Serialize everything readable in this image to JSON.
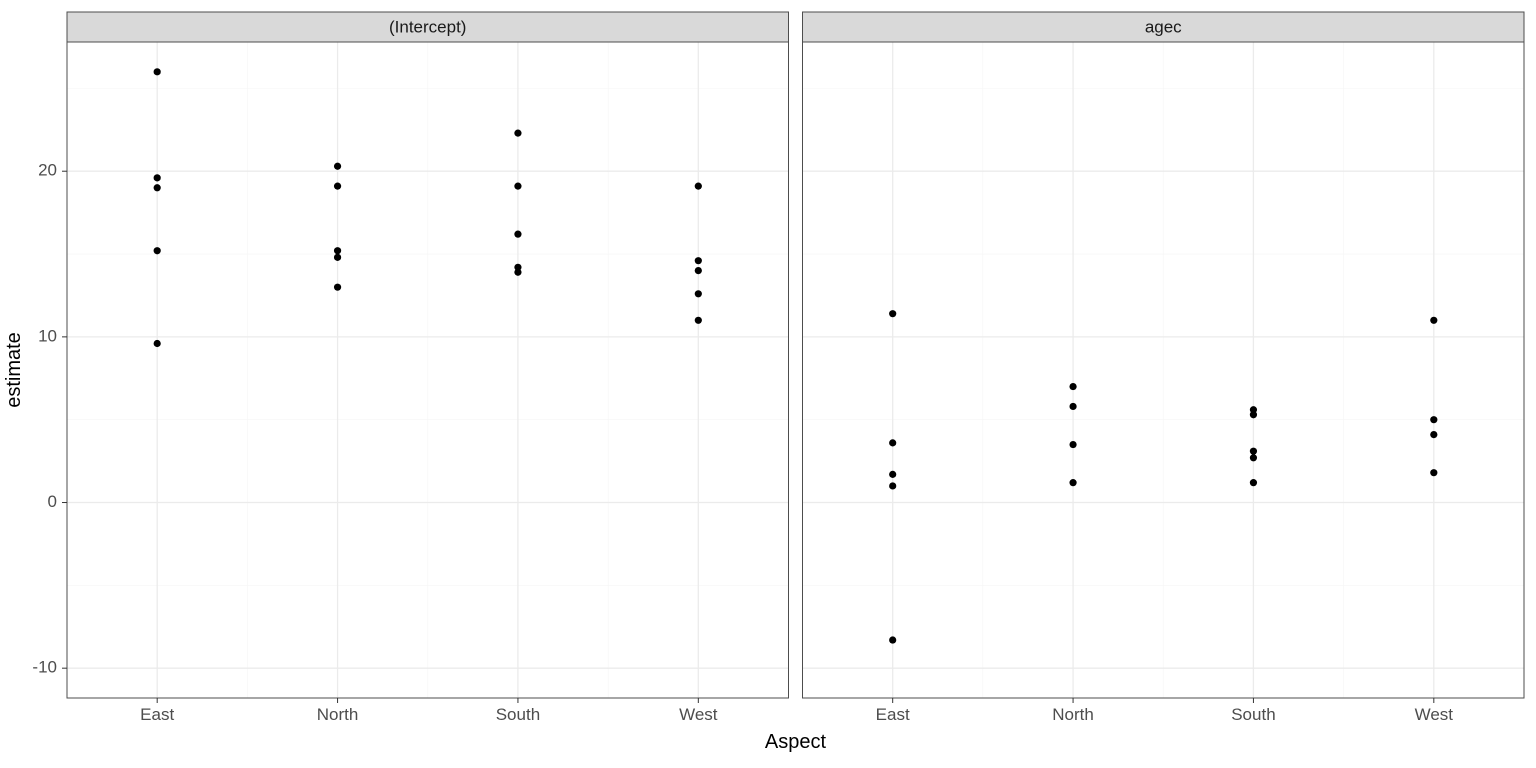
{
  "chart_data": [
    {
      "type": "scatter",
      "facet_label": "(Intercept)",
      "x_categories": [
        "East",
        "North",
        "South",
        "West"
      ],
      "series": [
        {
          "name": "(Intercept)",
          "points": [
            {
              "x": "East",
              "y": 26.0
            },
            {
              "x": "East",
              "y": 19.6
            },
            {
              "x": "East",
              "y": 19.0
            },
            {
              "x": "East",
              "y": 15.2
            },
            {
              "x": "East",
              "y": 9.6
            },
            {
              "x": "North",
              "y": 20.3
            },
            {
              "x": "North",
              "y": 19.1
            },
            {
              "x": "North",
              "y": 15.2
            },
            {
              "x": "North",
              "y": 14.8
            },
            {
              "x": "North",
              "y": 13.0
            },
            {
              "x": "South",
              "y": 22.3
            },
            {
              "x": "South",
              "y": 19.1
            },
            {
              "x": "South",
              "y": 16.2
            },
            {
              "x": "South",
              "y": 14.2
            },
            {
              "x": "South",
              "y": 13.9
            },
            {
              "x": "West",
              "y": 19.1
            },
            {
              "x": "West",
              "y": 14.6
            },
            {
              "x": "West",
              "y": 14.0
            },
            {
              "x": "West",
              "y": 12.6
            },
            {
              "x": "West",
              "y": 11.0
            }
          ]
        }
      ]
    },
    {
      "type": "scatter",
      "facet_label": "agec",
      "x_categories": [
        "East",
        "North",
        "South",
        "West"
      ],
      "series": [
        {
          "name": "agec",
          "points": [
            {
              "x": "East",
              "y": 11.4
            },
            {
              "x": "East",
              "y": 3.6
            },
            {
              "x": "East",
              "y": 1.7
            },
            {
              "x": "East",
              "y": 1.0
            },
            {
              "x": "East",
              "y": -8.3
            },
            {
              "x": "North",
              "y": 7.0
            },
            {
              "x": "North",
              "y": 5.8
            },
            {
              "x": "North",
              "y": 3.5
            },
            {
              "x": "North",
              "y": 1.2
            },
            {
              "x": "South",
              "y": 5.6
            },
            {
              "x": "South",
              "y": 5.3
            },
            {
              "x": "South",
              "y": 3.1
            },
            {
              "x": "South",
              "y": 2.7
            },
            {
              "x": "South",
              "y": 1.2
            },
            {
              "x": "West",
              "y": 11.0
            },
            {
              "x": "West",
              "y": 5.0
            },
            {
              "x": "West",
              "y": 4.1
            },
            {
              "x": "West",
              "y": 1.8
            }
          ]
        }
      ]
    }
  ],
  "axes": {
    "xlabel": "Aspect",
    "ylabel": "estimate",
    "y_ticks": [
      -10,
      0,
      10,
      20
    ],
    "y_minor": [
      -5,
      5,
      15,
      25
    ],
    "ylim": [
      -11.8,
      27.8
    ]
  },
  "facets": {
    "labels": [
      "(Intercept)",
      "agec"
    ]
  },
  "categories": [
    "East",
    "North",
    "South",
    "West"
  ]
}
